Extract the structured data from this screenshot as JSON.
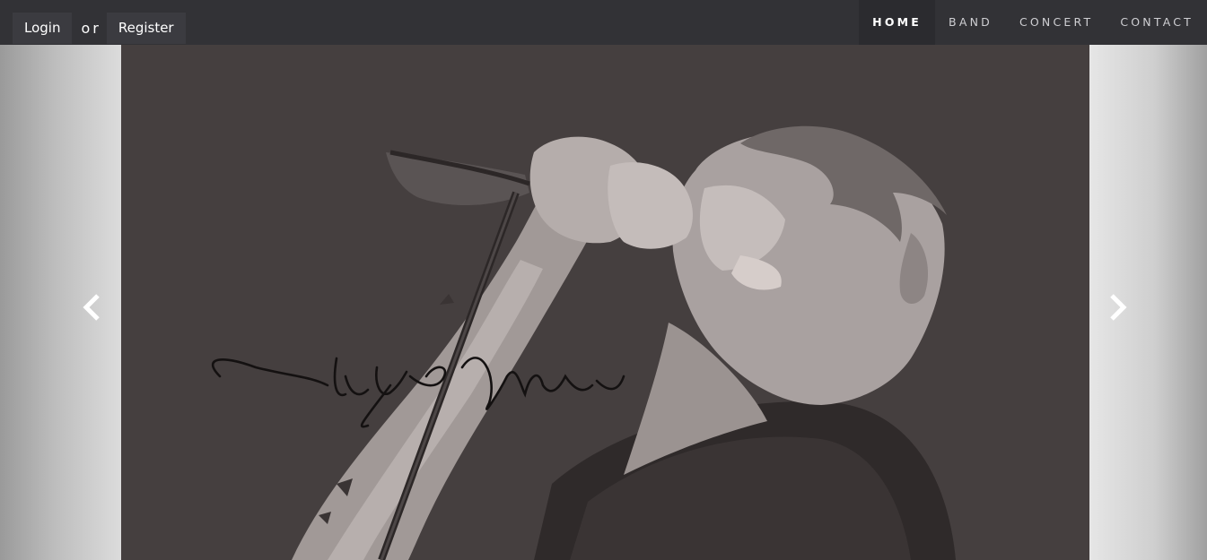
{
  "auth": {
    "login_label": "Login",
    "or_label": "or",
    "register_label": "Register"
  },
  "nav": {
    "items": [
      {
        "label": "HOME",
        "active": true
      },
      {
        "label": "BAND",
        "active": false
      },
      {
        "label": "CONCERT",
        "active": false
      },
      {
        "label": "CONTACT",
        "active": false
      }
    ]
  },
  "carousel": {
    "prev_icon": "chevron-left-icon",
    "next_icon": "chevron-right-icon",
    "slide_image": "singer-with-microphone-illustration",
    "signature": "Chito Miranda"
  },
  "colors": {
    "navbar_bg": "#323236",
    "slide_bg": "#453f3f",
    "nav_text": "#cfcfd3",
    "nav_active_text": "#ffffff"
  }
}
